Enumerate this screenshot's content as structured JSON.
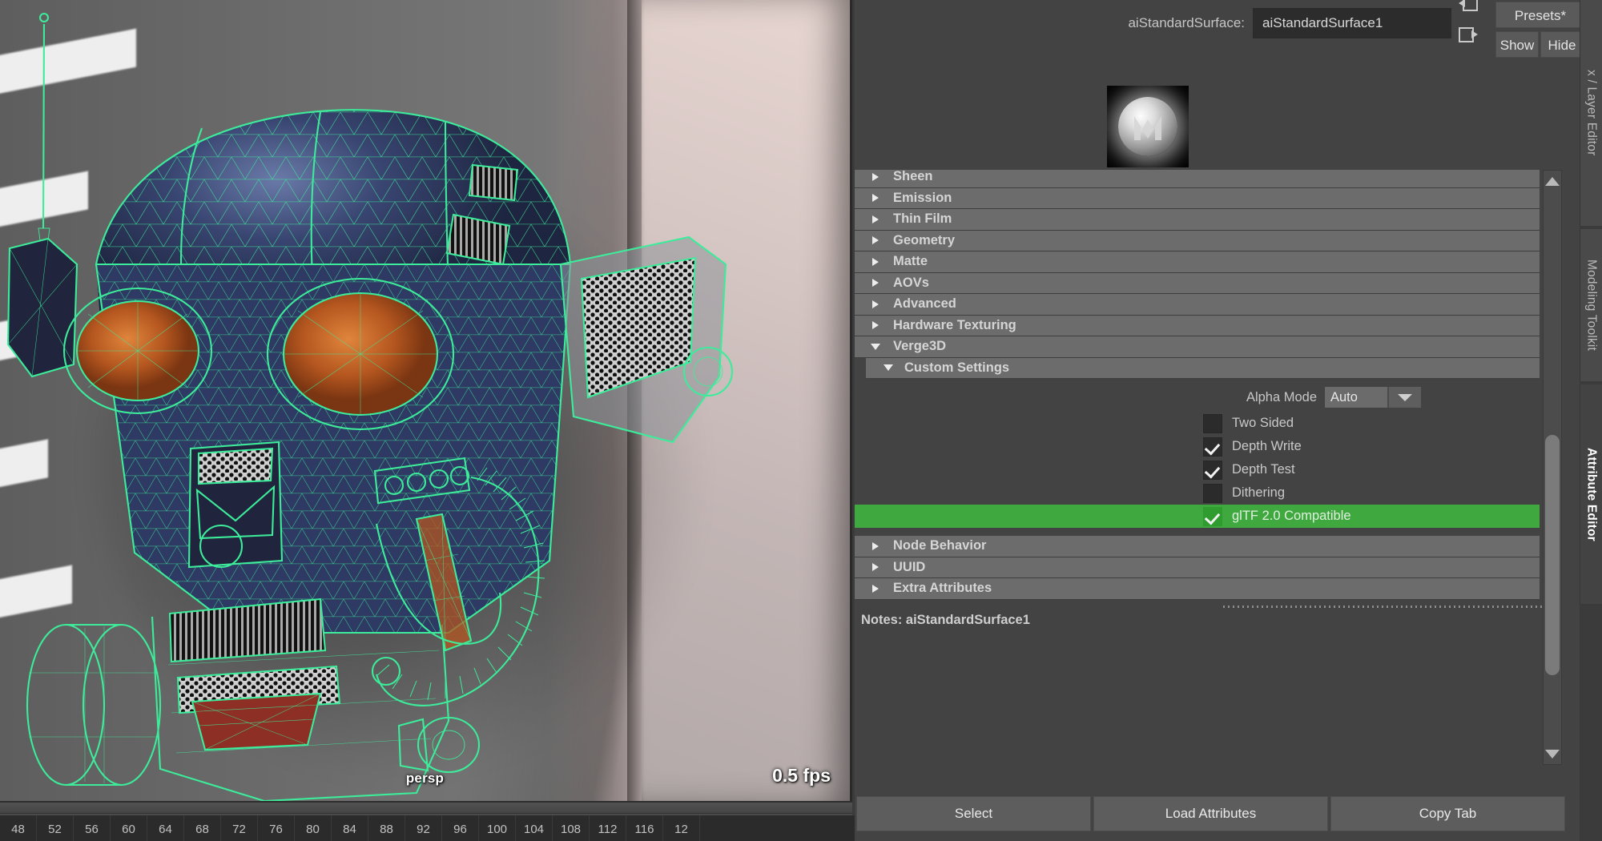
{
  "viewport": {
    "camera_label": "persp",
    "fps": "0.5 fps",
    "wireframe_color": "#3dec9a",
    "scene_description": "wireframe-shaded robot head model"
  },
  "timeline": {
    "ticks": [
      "48",
      "52",
      "56",
      "60",
      "64",
      "68",
      "72",
      "76",
      "80",
      "84",
      "88",
      "92",
      "96",
      "100",
      "104",
      "108",
      "112",
      "116",
      "12"
    ]
  },
  "attribute_editor": {
    "node_type_label": "aiStandardSurface:",
    "node_name": "aiStandardSurface1",
    "buttons": {
      "focus": "",
      "presets": "Presets*",
      "show": "Show",
      "hide": "Hide"
    },
    "icons": {
      "input_connection": "arrow-into-box-icon",
      "output_connection": "arrow-out-of-box-icon"
    },
    "swatch": {
      "name": "material-preview-swatch"
    },
    "sections": [
      {
        "label": "Sheen",
        "open": false
      },
      {
        "label": "Emission",
        "open": false
      },
      {
        "label": "Thin Film",
        "open": false
      },
      {
        "label": "Geometry",
        "open": false
      },
      {
        "label": "Matte",
        "open": false
      },
      {
        "label": "AOVs",
        "open": false
      },
      {
        "label": "Advanced",
        "open": false
      },
      {
        "label": "Hardware Texturing",
        "open": false
      },
      {
        "label": "Verge3D",
        "open": true
      }
    ],
    "custom_settings": {
      "label": "Custom Settings",
      "open": true,
      "alpha_mode": {
        "label": "Alpha Mode",
        "value": "Auto"
      },
      "checkboxes": [
        {
          "label": "Two Sided",
          "checked": false,
          "highlighted": false
        },
        {
          "label": "Depth Write",
          "checked": true,
          "highlighted": false
        },
        {
          "label": "Depth Test",
          "checked": true,
          "highlighted": false
        },
        {
          "label": "Dithering",
          "checked": false,
          "highlighted": false
        },
        {
          "label": "glTF 2.0 Compatible",
          "checked": true,
          "highlighted": true
        }
      ],
      "highlight_color": "#3fa83f"
    },
    "trailing_sections": [
      {
        "label": "Node Behavior",
        "open": false
      },
      {
        "label": "UUID",
        "open": false
      },
      {
        "label": "Extra Attributes",
        "open": false
      }
    ],
    "notes": "Notes:  aiStandardSurface1",
    "footer_buttons": [
      "Select",
      "Load Attributes",
      "Copy Tab"
    ]
  },
  "right_rail": {
    "tabs": [
      {
        "label": "x / Layer Editor",
        "active": false
      },
      {
        "label": "Modeling Toolkit",
        "active": false
      },
      {
        "label": "Attribute Editor",
        "active": true
      }
    ]
  }
}
